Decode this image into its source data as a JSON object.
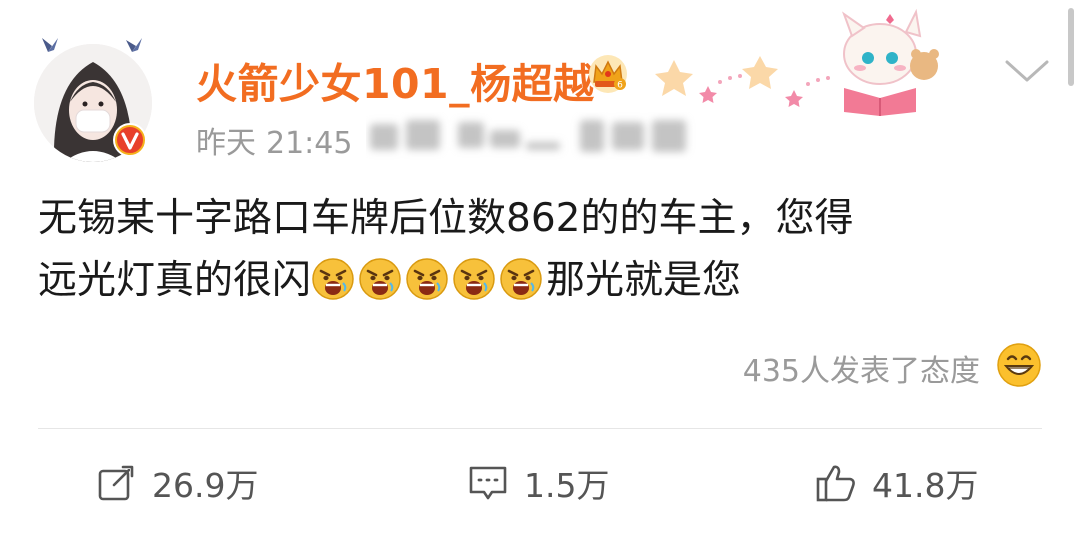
{
  "user": {
    "name": "火箭少女101_杨超越",
    "verified": true
  },
  "post": {
    "meta_day": "昨天",
    "meta_time": "21:45",
    "text_line1": "无锡某十字路口车牌后位数862的的车主，您得",
    "text_line2_before": "远光灯真的很闪",
    "text_line2_after": "那光就是您",
    "angry_emoji_count": 5
  },
  "reactions": {
    "label": "435人发表了态度"
  },
  "actions": {
    "repost_count": "26.9万",
    "comment_count": "1.5万",
    "like_count": "41.8万"
  },
  "icons": {
    "avatar": "avatar-photo",
    "verified": "verified-v-badge",
    "vip": "vip-crown-icon",
    "decoration": "cartoon-reading-animals-decoration",
    "more": "chevron-down-icon",
    "angry": "angry-face-emoji",
    "laugh": "laughing-face-emoji",
    "repost": "share-icon",
    "comment": "comment-icon",
    "like": "thumbs-up-icon"
  },
  "colors": {
    "username": "#f26d21",
    "text": "#1a1a1a",
    "muted": "#9a9a9a",
    "verified_badge": "#e8402a",
    "action_text": "#555555"
  }
}
